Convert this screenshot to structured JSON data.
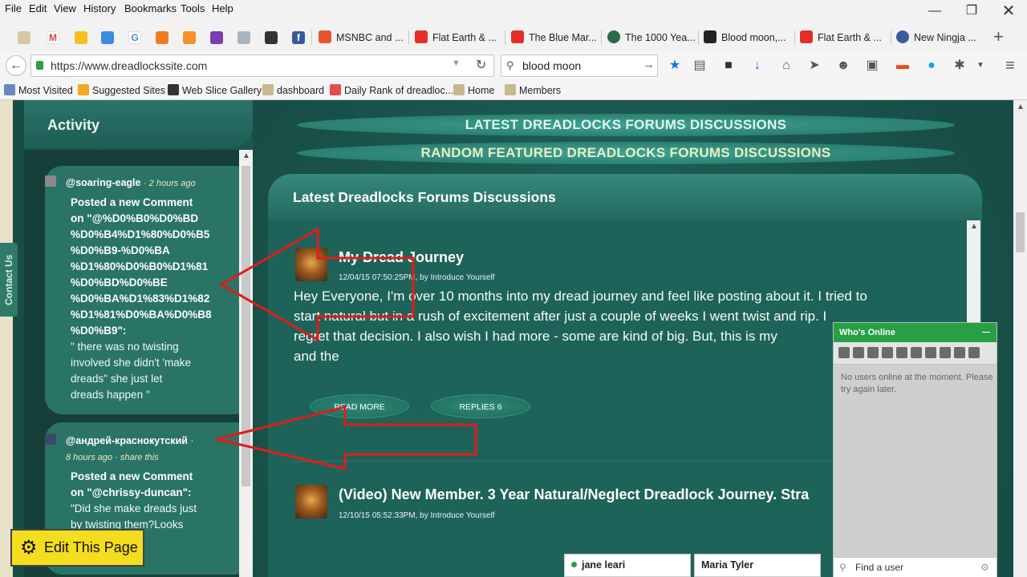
{
  "menu": [
    "File",
    "Edit",
    "View",
    "History",
    "Bookmarks",
    "Tools",
    "Help"
  ],
  "tabs": [
    {
      "label": "MSNBC and ...",
      "color": "#e8542e"
    },
    {
      "label": "Flat Earth & ...",
      "color": "#e52d27"
    },
    {
      "label": "The Blue Mar...",
      "color": "#e52d27"
    },
    {
      "label": "The 1000 Yea...",
      "color": "#2a6a4a"
    },
    {
      "label": "Blood moon,...",
      "color": "#222"
    },
    {
      "label": "Flat Earth & ...",
      "color": "#e52d27"
    },
    {
      "label": "New Ningja ...",
      "color": "#3b5aa0"
    }
  ],
  "nav": {
    "url": "https://www.dreadlockssite.com",
    "search": "blood moon"
  },
  "bookmarks": [
    "Most Visited",
    "Suggested Sites",
    "Web Slice Gallery",
    "dashboard",
    "Daily Rank of dreadloc...",
    "Home",
    "Members"
  ],
  "contact": "Contact Us",
  "activity": {
    "title": "Activity",
    "items": [
      {
        "user": "@soaring-eagle",
        "time": "· 2 hours ago",
        "lines": [
          "Posted a new Comment",
          "on \"@%D0%B0%D0%BD",
          "%D0%B4%D1%80%D0%B5",
          "%D0%B9-%D0%BA",
          "%D1%80%D0%B0%D1%81",
          "%D0%BD%D0%BE",
          "%D0%BA%D1%83%D1%82",
          "%D1%81%D0%BA%D0%B8",
          "%D0%B9\":"
        ],
        "quote": [
          "\" there was no twisting",
          "involved she didn't 'make",
          "dreads\"  she just let",
          "dreads happen \""
        ]
      },
      {
        "user": "@андрей-краснокутский",
        "dot": "·",
        "time": "8 hours ago · share this",
        "lines": [
          "Posted a new Comment",
          "on \"@chrissy-duncan\":"
        ],
        "quote": [
          "\"Did she make dreads just",
          "by twisting them?Looks"
        ]
      }
    ]
  },
  "main": {
    "tab1": "LATEST DREADLOCKS FORUMS DISCUSSIONS",
    "tab2": "RANDOM FEATURED DREADLOCKS FORUMS DISCUSSIONS",
    "panel_title": "Latest Dreadlocks Forums Discussions",
    "posts": [
      {
        "title": "My Dread Journey",
        "date": "12/04/15 07:50:25PM, by ",
        "author": "Introduce Yourself",
        "body": [
          "Hey Everyone, I'm over 10 months into my dread journey and feel like posting about it. I tried to",
          "start natural but in a rush of excitement after just a couple of weeks I went twist and rip. I",
          "regret that decision. I also wish I had more - some are kind of big. But, this is my",
          "and the"
        ],
        "read_more": "READ MORE",
        "replies": "REPLIES 6"
      },
      {
        "title": "(Video) New Member. 3 Year Natural/Neglect Dreadlock Journey. Stra",
        "date": "12/10/15 05:52:33PM, by ",
        "author": "Introduce Yourself"
      }
    ]
  },
  "whos_online": {
    "title": "Who's Online",
    "minimize": "—",
    "message": "No users online at the moment. Please try again later.",
    "find": "Find a user"
  },
  "chat_users": [
    "jane leari",
    "Maria Tyler"
  ],
  "edit_button": "Edit This Page",
  "colors": {
    "accent_green": "#27a045",
    "link_yellow": "#f0e7b8",
    "heading_teal": "#dff7ee",
    "random_title": "#e8f0c0",
    "edit_yellow": "#f4dd1e"
  }
}
